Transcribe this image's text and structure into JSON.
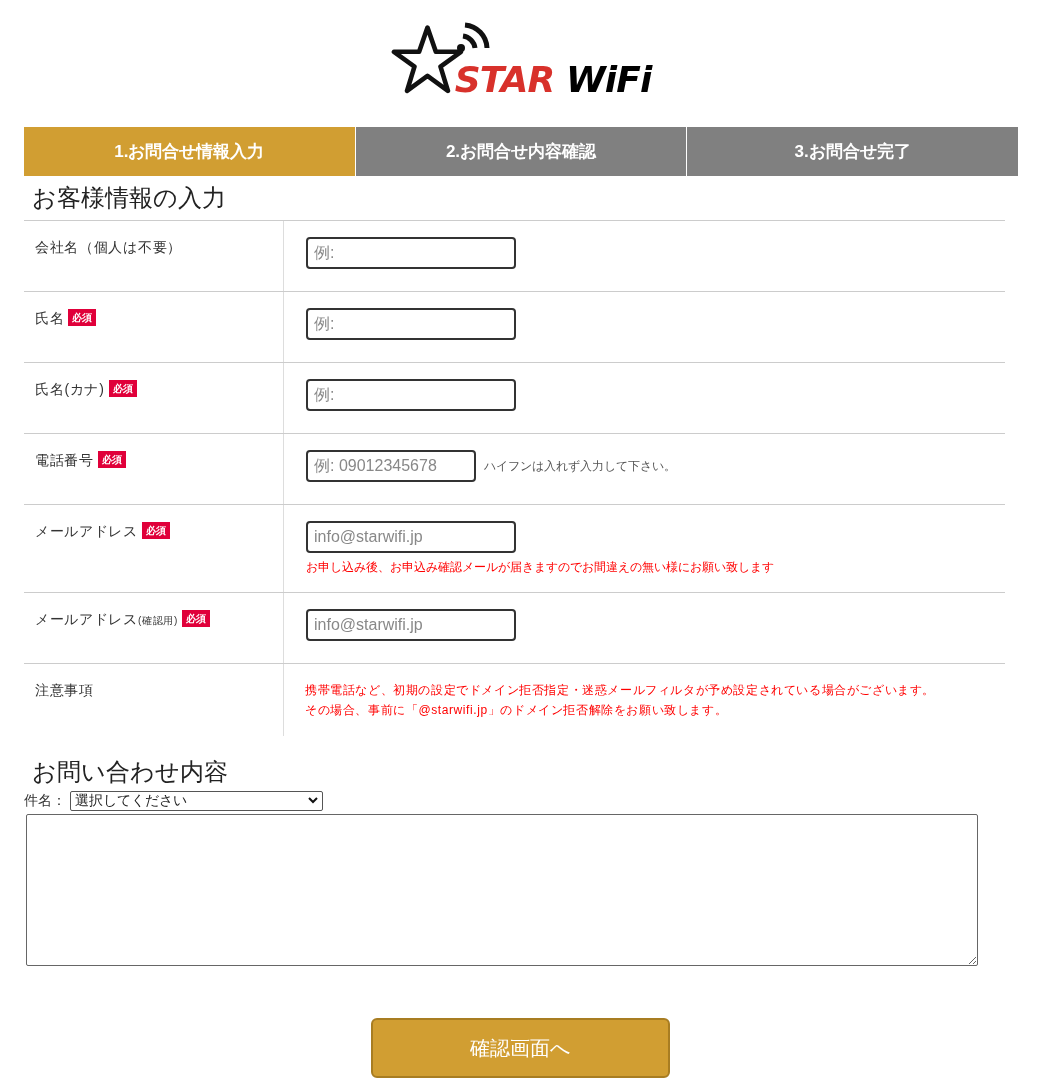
{
  "logo": {
    "star_text": "STAR",
    "wifi_text": "WiFi"
  },
  "steps": [
    {
      "label": "1.お問合せ情報入力",
      "selected": true
    },
    {
      "label": "2.お問合せ内容確認",
      "selected": false
    },
    {
      "label": "3.お問合せ完了",
      "selected": false
    }
  ],
  "customer_section": {
    "title": "お客様情報の入力",
    "rows": [
      {
        "kind": "field",
        "label": "会社名（個人は不要）",
        "required": false,
        "placeholder": "例:"
      },
      {
        "kind": "field",
        "label": "氏名",
        "required": true,
        "badge": "必須",
        "placeholder": "例:"
      },
      {
        "kind": "field",
        "label": "氏名(カナ)",
        "required": true,
        "badge": "必須",
        "placeholder": "例:"
      },
      {
        "kind": "field",
        "label": "電話番号",
        "required": true,
        "badge": "必須",
        "placeholder": "例: 09012345678",
        "side_hint": "ハイフンは入れず入力して下さい。"
      },
      {
        "kind": "field",
        "label": "メールアドレス",
        "required": true,
        "badge": "必須",
        "placeholder": "info@starwifi.jp",
        "warning": "お申し込み後、お申込み確認メールが届きますのでお間違えの無い様にお願い致します"
      },
      {
        "kind": "field",
        "label": "メールアドレス",
        "label_small": "(確認用)",
        "required": true,
        "badge": "必須",
        "placeholder": "info@starwifi.jp"
      },
      {
        "kind": "notice",
        "label": "注意事項",
        "lines": [
          "携帯電話など、初期の設定でドメイン拒否指定・迷惑メールフィルタが予め設定されている場合がございます。",
          "その場合、事前に「@starwifi.jp」のドメイン拒否解除をお願い致します。"
        ]
      }
    ]
  },
  "inquiry_section": {
    "title": "お問い合わせ内容",
    "subject_label": "件名：",
    "subject_value": "選択してください"
  },
  "submit_button": "確認画面へ"
}
